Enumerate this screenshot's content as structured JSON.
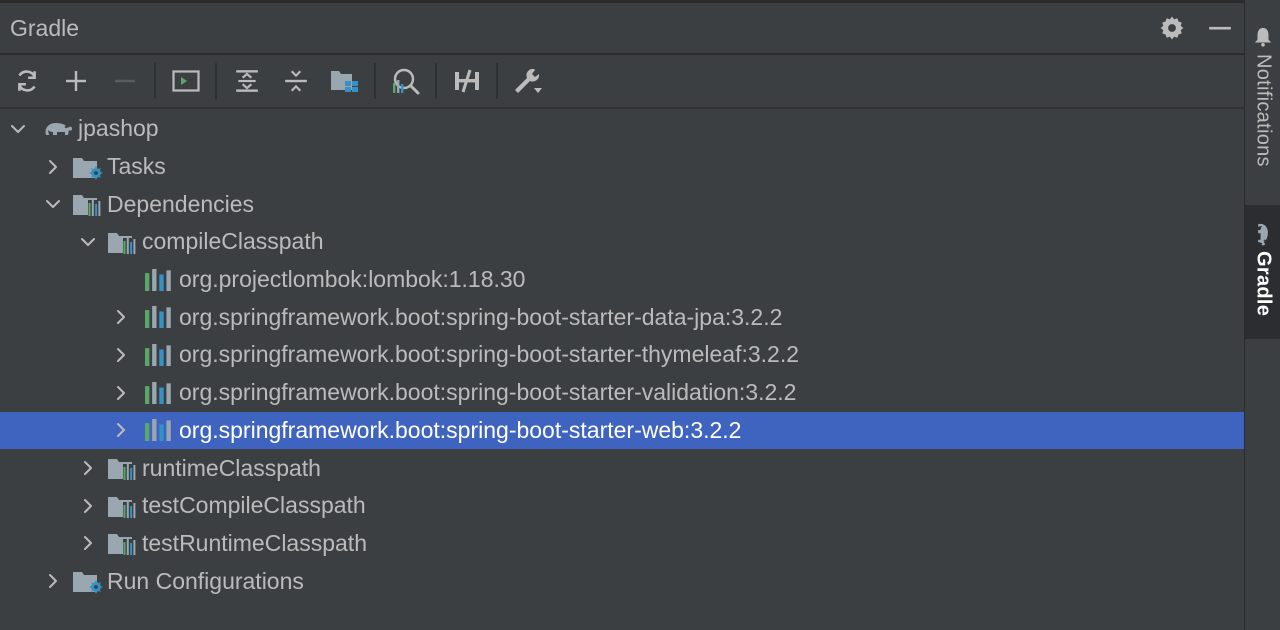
{
  "panel": {
    "title": "Gradle",
    "header_buttons": [
      "gear-icon",
      "minimize-icon"
    ]
  },
  "toolbar": {
    "buttons": [
      {
        "name": "reload-button",
        "icon": "refresh-icon"
      },
      {
        "name": "add-button",
        "icon": "plus-icon"
      },
      {
        "name": "remove-button",
        "icon": "minus-icon",
        "disabled": true
      },
      {
        "name": "run-task-button",
        "icon": "terminal-icon"
      },
      {
        "name": "expand-all-button",
        "icon": "expand-all-icon"
      },
      {
        "name": "collapse-all-button",
        "icon": "collapse-all-icon"
      },
      {
        "name": "group-modules-button",
        "icon": "folder-modules-icon"
      },
      {
        "name": "analyze-dependencies-button",
        "icon": "analyze-icon"
      },
      {
        "name": "toggle-offline-button",
        "icon": "offline-icon"
      },
      {
        "name": "build-settings-button",
        "icon": "wrench-icon"
      }
    ]
  },
  "tree": {
    "root": "jpashop",
    "tasks": "Tasks",
    "dependencies": "Dependencies",
    "compile_classpath": "compileClasspath",
    "deps": [
      "org.projectlombok:lombok:1.18.30",
      "org.springframework.boot:spring-boot-starter-data-jpa:3.2.2",
      "org.springframework.boot:spring-boot-starter-thymeleaf:3.2.2",
      "org.springframework.boot:spring-boot-starter-validation:3.2.2",
      "org.springframework.boot:spring-boot-starter-web:3.2.2"
    ],
    "runtime_classpath": "runtimeClasspath",
    "test_compile_classpath": "testCompileClasspath",
    "test_runtime_classpath": "testRuntimeClasspath",
    "run_configurations": "Run Configurations"
  },
  "side_strip": {
    "notifications": "Notifications",
    "gradle": "Gradle"
  },
  "colors": {
    "background": "#3c3f41",
    "selection": "#3f64c0",
    "text": "#bbbbbb",
    "accent_blue": "#3592c4",
    "accent_green": "#59a869"
  }
}
